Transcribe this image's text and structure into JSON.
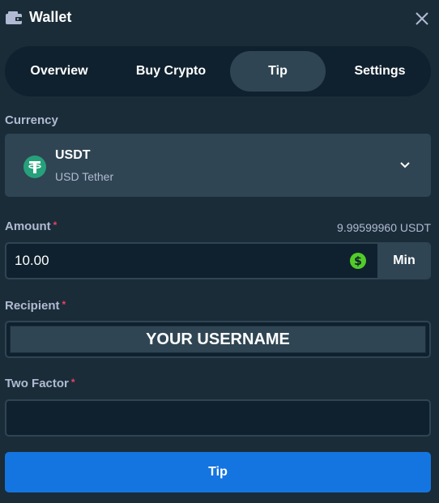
{
  "header": {
    "title": "Wallet",
    "icon": "wallet-icon",
    "close_icon": "close-icon"
  },
  "tabs": [
    {
      "label": "Overview",
      "active": false
    },
    {
      "label": "Buy Crypto",
      "active": false
    },
    {
      "label": "Tip",
      "active": true
    },
    {
      "label": "Settings",
      "active": false
    }
  ],
  "currency": {
    "label": "Currency",
    "code": "USDT",
    "name": "USD Tether",
    "coin_icon": "tether-icon",
    "coin_color": "#26a17b"
  },
  "amount": {
    "label": "Amount",
    "required_mark": "*",
    "balance": "9.99599960 USDT",
    "value": "10.00",
    "currency_icon": "dollar-coin-icon",
    "currency_icon_color": "#52cc29",
    "min_label": "Min"
  },
  "recipient": {
    "label": "Recipient",
    "required_mark": "*",
    "value": "YOUR USERNAME"
  },
  "two_factor": {
    "label": "Two Factor",
    "required_mark": "*",
    "value": ""
  },
  "submit": {
    "label": "Tip"
  },
  "colors": {
    "background": "#1a2c38",
    "panel": "#0f212e",
    "field": "#2f4553",
    "accent_blue": "#1475e1",
    "required_red": "#ed4163",
    "muted_text": "#b1bad3"
  }
}
